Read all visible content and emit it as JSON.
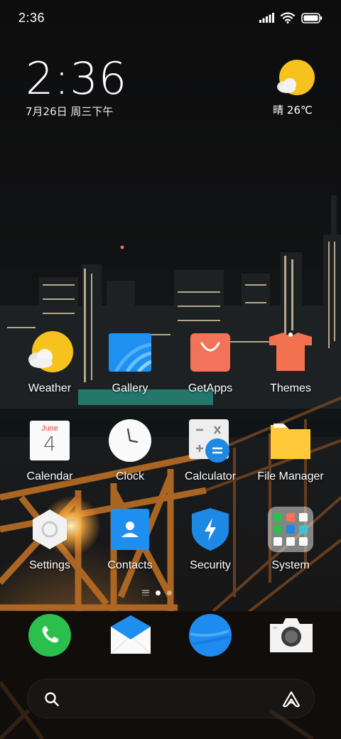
{
  "status_bar": {
    "time": "2:36"
  },
  "clock_widget": {
    "time": "2:36",
    "date": "7月26日 周三下午"
  },
  "weather_widget": {
    "condition_temp": "晴 26℃",
    "icon": "sunny-partly-cloudy-icon"
  },
  "apps": [
    {
      "label": "Weather",
      "icon": "weather-icon"
    },
    {
      "label": "Gallery",
      "icon": "gallery-icon"
    },
    {
      "label": "GetApps",
      "icon": "getapps-icon"
    },
    {
      "label": "Themes",
      "icon": "themes-icon"
    },
    {
      "label": "Calendar",
      "icon": "calendar-icon",
      "calendar_month": "June",
      "calendar_day": "4"
    },
    {
      "label": "Clock",
      "icon": "clock-icon"
    },
    {
      "label": "Calculator",
      "icon": "calculator-icon"
    },
    {
      "label": "File Manager",
      "icon": "file-manager-icon"
    },
    {
      "label": "Settings",
      "icon": "settings-icon"
    },
    {
      "label": "Contacts",
      "icon": "contacts-icon"
    },
    {
      "label": "Security",
      "icon": "security-icon"
    },
    {
      "label": "System",
      "icon": "system-folder-icon"
    }
  ],
  "dock": [
    {
      "icon": "phone-icon"
    },
    {
      "icon": "messages-icon"
    },
    {
      "icon": "browser-icon"
    },
    {
      "icon": "camera-icon"
    }
  ],
  "page_indicator": {
    "pages": 2,
    "active_page": 1
  },
  "colors": {
    "weather_yellow": "#F7C21E",
    "gallery_blue": "#1E90F0",
    "getapps_orange": "#F2725A",
    "themes_orange": "#F2714E",
    "calendar_red": "#E8483D",
    "file_yellow": "#FFC93A",
    "contacts_blue": "#1E8EF0",
    "security_blue": "#1E88E5",
    "phone_green": "#2BC04E",
    "browser_blue": "#1E8BF0"
  }
}
